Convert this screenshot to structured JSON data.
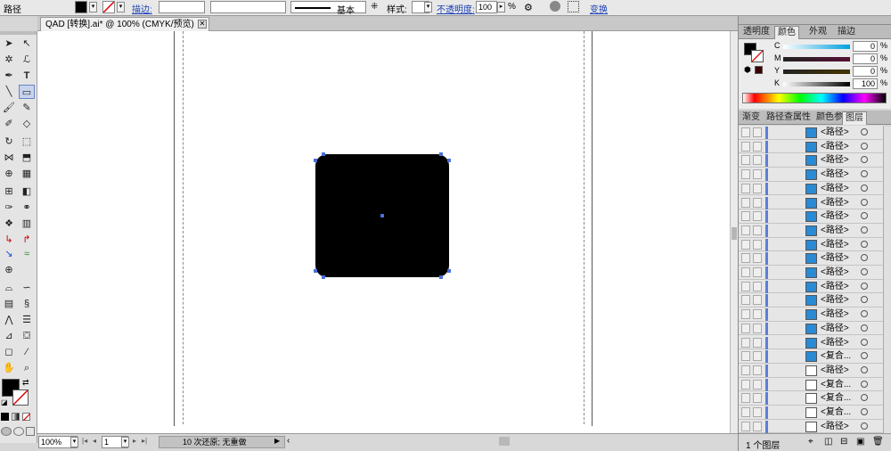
{
  "control_bar": {
    "selection_label": "路径",
    "stroke_label": "描边:",
    "stroke_profile": "基本",
    "style_label": "样式:",
    "opacity_label": "不透明度:",
    "opacity_value": "100",
    "opacity_unit": "%",
    "transform_label": "变换"
  },
  "document": {
    "tab_title": "QAD [转换].ai* @ 100% (CMYK/预览)",
    "close_glyph": "✕"
  },
  "status_bar": {
    "zoom": "100%",
    "artboard_number": "1",
    "undo_status": "10 次还原; 无重做"
  },
  "color_panel": {
    "tabs": [
      "透明度",
      "颜色",
      "外观",
      "描边"
    ],
    "active_tab": "颜色",
    "channels": [
      {
        "name": "C",
        "value": "0"
      },
      {
        "name": "M",
        "value": "0"
      },
      {
        "name": "Y",
        "value": "0"
      },
      {
        "name": "K",
        "value": "100"
      }
    ],
    "unit": "%"
  },
  "layers_panel": {
    "tabs": [
      "渐变",
      "路径查",
      "属性",
      "颜色参",
      "图层"
    ],
    "active_tab": "图层",
    "rows": [
      {
        "name": "<路径>",
        "thumb": "blue"
      },
      {
        "name": "<路径>",
        "thumb": "blue"
      },
      {
        "name": "<路径>",
        "thumb": "blue"
      },
      {
        "name": "<路径>",
        "thumb": "blue"
      },
      {
        "name": "<路径>",
        "thumb": "blue"
      },
      {
        "name": "<路径>",
        "thumb": "blue"
      },
      {
        "name": "<路径>",
        "thumb": "blue"
      },
      {
        "name": "<路径>",
        "thumb": "blue"
      },
      {
        "name": "<路径>",
        "thumb": "blue"
      },
      {
        "name": "<路径>",
        "thumb": "blue"
      },
      {
        "name": "<路径>",
        "thumb": "blue"
      },
      {
        "name": "<路径>",
        "thumb": "blue"
      },
      {
        "name": "<路径>",
        "thumb": "blue"
      },
      {
        "name": "<路径>",
        "thumb": "blue"
      },
      {
        "name": "<路径>",
        "thumb": "blue"
      },
      {
        "name": "<路径>",
        "thumb": "blue"
      },
      {
        "name": "<复合...",
        "thumb": "blue"
      },
      {
        "name": "<路径>",
        "thumb": "dark"
      },
      {
        "name": "<复合...",
        "thumb": "dark"
      },
      {
        "name": "<复合...",
        "thumb": "dark"
      },
      {
        "name": "<复合...",
        "thumb": "dark"
      },
      {
        "name": "<路径>",
        "thumb": "dark"
      }
    ],
    "footer_count": "1 个图层"
  },
  "colors": {
    "fill": "#000000",
    "selection": "#4a6fd8",
    "panel_bg": "#d4d4d4"
  }
}
